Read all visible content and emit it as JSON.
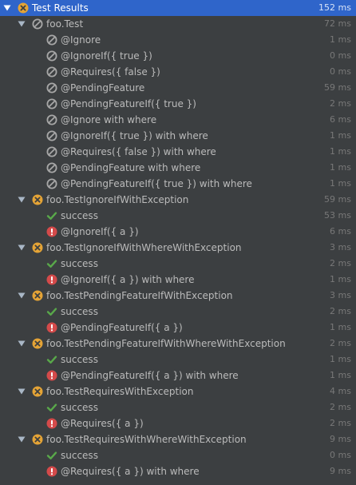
{
  "colors": {
    "background": "#3c3f41",
    "selected": "#2f65ca",
    "fail": "#e5a436",
    "ignored": "#a7a7a7",
    "pass": "#59a84a",
    "error": "#d44a4a"
  },
  "rows": [
    {
      "level": 0,
      "expander": true,
      "icon": "failed-icon",
      "label": "Test Results",
      "duration": "152 ms",
      "selected": true
    },
    {
      "level": 1,
      "expander": true,
      "icon": "ignored-icon",
      "label": "foo.Test",
      "duration": "72 ms"
    },
    {
      "level": 2,
      "icon": "ignored-icon",
      "label": "@Ignore",
      "duration": "1 ms"
    },
    {
      "level": 2,
      "icon": "ignored-icon",
      "label": "@IgnoreIf({ true })",
      "duration": "0 ms"
    },
    {
      "level": 2,
      "icon": "ignored-icon",
      "label": "@Requires({ false })",
      "duration": "0 ms"
    },
    {
      "level": 2,
      "icon": "ignored-icon",
      "label": "@PendingFeature",
      "duration": "59 ms"
    },
    {
      "level": 2,
      "icon": "ignored-icon",
      "label": "@PendingFeatureIf({ true })",
      "duration": "2 ms"
    },
    {
      "level": 2,
      "icon": "ignored-icon",
      "label": "@Ignore with where",
      "duration": "6 ms"
    },
    {
      "level": 2,
      "icon": "ignored-icon",
      "label": "@IgnoreIf({ true }) with where",
      "duration": "1 ms"
    },
    {
      "level": 2,
      "icon": "ignored-icon",
      "label": "@Requires({ false }) with where",
      "duration": "1 ms"
    },
    {
      "level": 2,
      "icon": "ignored-icon",
      "label": "@PendingFeature with where",
      "duration": "1 ms"
    },
    {
      "level": 2,
      "icon": "ignored-icon",
      "label": "@PendingFeatureIf({ true }) with where",
      "duration": "1 ms"
    },
    {
      "level": 1,
      "expander": true,
      "icon": "failed-icon",
      "label": "foo.TestIgnoreIfWithException",
      "duration": "59 ms"
    },
    {
      "level": 2,
      "icon": "passed-icon",
      "label": "success",
      "duration": "53 ms"
    },
    {
      "level": 2,
      "icon": "error-icon",
      "label": "@IgnoreIf({ a })",
      "duration": "6 ms"
    },
    {
      "level": 1,
      "expander": true,
      "icon": "failed-icon",
      "label": "foo.TestIgnoreIfWithWhereWithException",
      "duration": "3 ms"
    },
    {
      "level": 2,
      "icon": "passed-icon",
      "label": "success",
      "duration": "2 ms"
    },
    {
      "level": 2,
      "icon": "error-icon",
      "label": "@IgnoreIf({ a }) with where",
      "duration": "1 ms"
    },
    {
      "level": 1,
      "expander": true,
      "icon": "failed-icon",
      "label": "foo.TestPendingFeatureIfWithException",
      "duration": "3 ms"
    },
    {
      "level": 2,
      "icon": "passed-icon",
      "label": "success",
      "duration": "2 ms"
    },
    {
      "level": 2,
      "icon": "error-icon",
      "label": "@PendingFeatureIf({ a })",
      "duration": "1 ms"
    },
    {
      "level": 1,
      "expander": true,
      "icon": "failed-icon",
      "label": "foo.TestPendingFeatureIfWithWhereWithException",
      "duration": "2 ms"
    },
    {
      "level": 2,
      "icon": "passed-icon",
      "label": "success",
      "duration": "1 ms"
    },
    {
      "level": 2,
      "icon": "error-icon",
      "label": "@PendingFeatureIf({ a }) with where",
      "duration": "1 ms"
    },
    {
      "level": 1,
      "expander": true,
      "icon": "failed-icon",
      "label": "foo.TestRequiresWithException",
      "duration": "4 ms"
    },
    {
      "level": 2,
      "icon": "passed-icon",
      "label": "success",
      "duration": "2 ms"
    },
    {
      "level": 2,
      "icon": "error-icon",
      "label": "@Requires({ a })",
      "duration": "2 ms"
    },
    {
      "level": 1,
      "expander": true,
      "icon": "failed-icon",
      "label": "foo.TestRequiresWithWhereWithException",
      "duration": "9 ms"
    },
    {
      "level": 2,
      "icon": "passed-icon",
      "label": "success",
      "duration": "0 ms"
    },
    {
      "level": 2,
      "icon": "error-icon",
      "label": "@Requires({ a }) with where",
      "duration": "9 ms"
    }
  ]
}
